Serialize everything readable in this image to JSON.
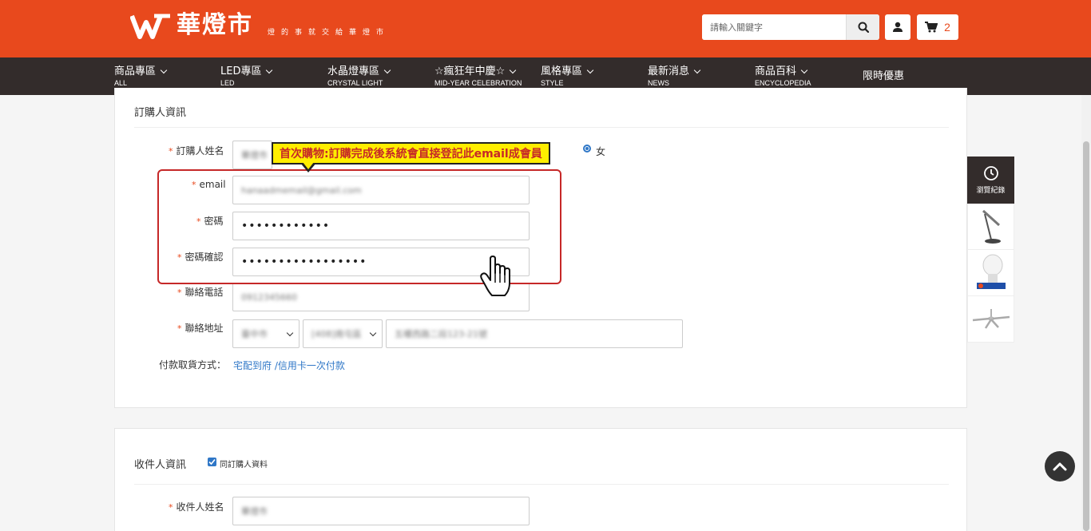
{
  "header": {
    "logo_name": "華燈市",
    "slogan": "燈的事就交給華燈市",
    "search_placeholder": "請輸入關鍵字",
    "cart_count": "2"
  },
  "nav": [
    {
      "label": "商品專區",
      "sub": "ALL",
      "has_menu": true
    },
    {
      "label": "LED專區",
      "sub": "LED",
      "has_menu": true
    },
    {
      "label": "水晶燈專區",
      "sub": "CRYSTAL LIGHT",
      "has_menu": true
    },
    {
      "label": "☆瘋狂年中慶☆",
      "sub": "MID-YEAR CELEBRATION",
      "has_menu": true
    },
    {
      "label": "風格專區",
      "sub": "STYLE",
      "has_menu": true
    },
    {
      "label": "最新消息",
      "sub": "NEWS",
      "has_menu": true
    },
    {
      "label": "商品百科",
      "sub": "ENCYCLOPEDIA",
      "has_menu": true
    },
    {
      "label": "限時優惠",
      "sub": "",
      "has_menu": false
    }
  ],
  "orderer": {
    "title": "訂購人資訊",
    "name_label": "訂購人姓名",
    "name_value": "華燈市",
    "gender_female": "女",
    "email_label": "email",
    "email_value": "hanaadmemail@gmail.com",
    "password_label": "密碼",
    "password_value": "••••••••••••",
    "password_confirm_label": "密碼確認",
    "password_confirm_value": "•••••••••••••••••",
    "phone_label": "聯絡電話",
    "phone_value": "0912345660",
    "address_label": "聯絡地址",
    "address_city": "臺中市",
    "address_district": "[408]南屯區",
    "address_street": "五權西路二段123-21號",
    "payment_label": "付款取貨方式：",
    "payment_value": "宅配到府 /信用卡一次付款"
  },
  "callout": {
    "text": "首次購物:訂購完成後系統會直接登記此email成會員"
  },
  "receiver": {
    "title": "收件人資訊",
    "same_as_label": "同訂購人資料",
    "name_label": "收件人姓名",
    "name_value": "華燈市"
  },
  "recent": {
    "label": "瀏覽紀錄"
  },
  "colors": {
    "brand": "#e8491d",
    "nav_bg": "#332c2b",
    "highlight": "#c62828",
    "callout_bg": "#ffee00",
    "link": "#2f77c7"
  }
}
